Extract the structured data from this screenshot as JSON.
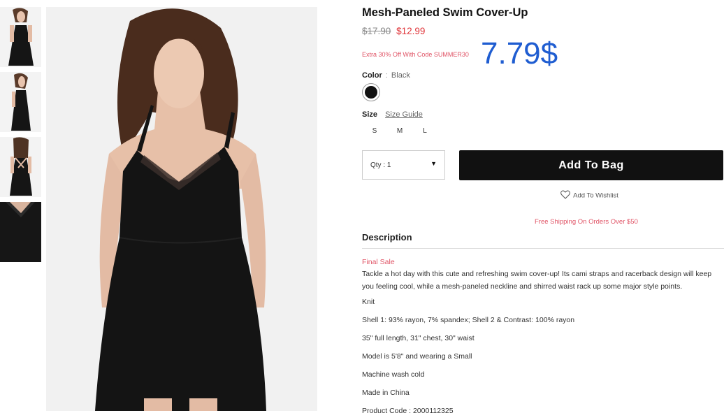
{
  "product": {
    "title": "Mesh-Paneled Swim Cover-Up",
    "original_price": "$17.90",
    "sale_price": "$12.99",
    "promo": "Extra 30% Off With Code SUMMER30",
    "overlay_price": "7.79$"
  },
  "color": {
    "label": "Color",
    "separator": ":",
    "value": "Black",
    "swatch_hex": "#111111"
  },
  "size": {
    "label": "Size",
    "guide_label": "Size Guide",
    "options": [
      "S",
      "M",
      "L"
    ]
  },
  "quantity": {
    "label": "Qty : 1"
  },
  "actions": {
    "add_to_bag": "Add To Bag",
    "wishlist": "Add To Wishlist"
  },
  "shipping_note": "Free Shipping On Orders Over $50",
  "description": {
    "heading": "Description",
    "final_sale": "Final Sale",
    "text": "Tackle a hot day with this cute and refreshing swim cover-up! Its cami straps and racerback design will keep you feeling cool, while a mesh-paneled neckline and shirred waist rack up some major style points.",
    "details": [
      "Knit",
      "Shell 1: 93% rayon, 7% spandex; Shell 2 & Contrast: 100% rayon",
      "35\" full length, 31\" chest, 30\" waist",
      "Model is 5'8\" and wearing a Small",
      "Machine wash cold",
      "Made in China",
      "Product Code : 2000112325"
    ]
  },
  "colors": {
    "accent_red": "#e0353a",
    "promo_pink": "#e05466",
    "overlay_blue": "#1f5dd1",
    "button_black": "#111111"
  }
}
